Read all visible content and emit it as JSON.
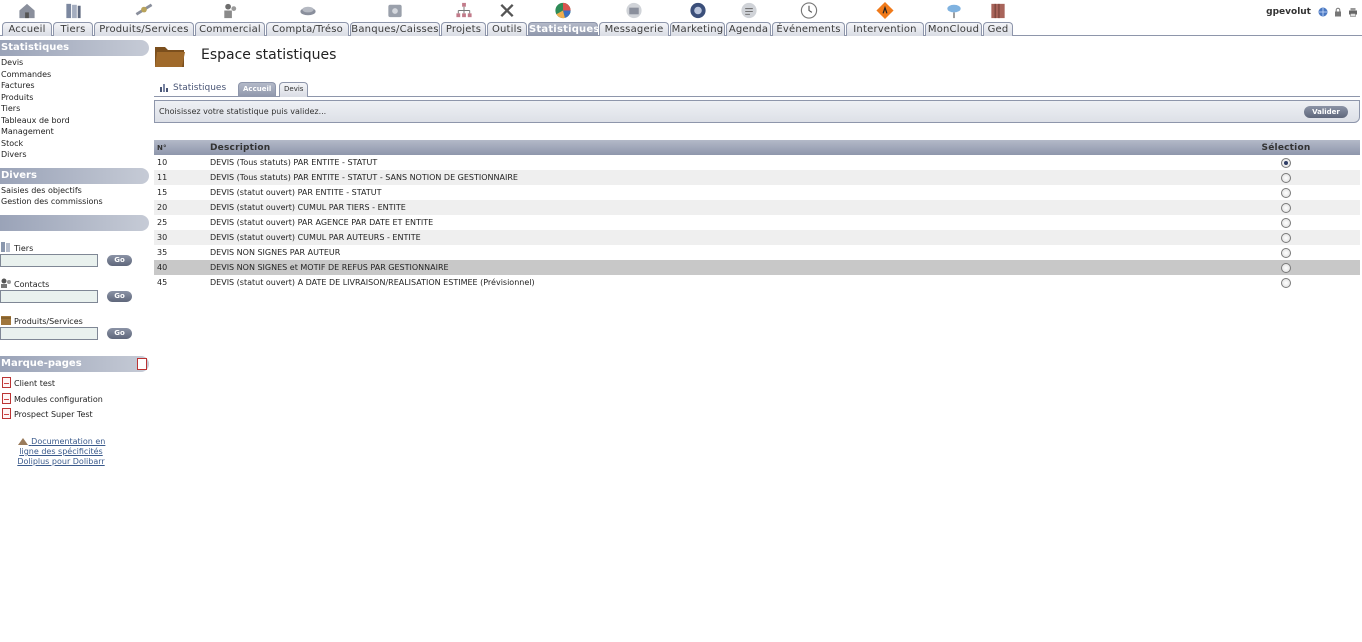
{
  "topmenu": {
    "tabs": [
      {
        "label": "Accueil",
        "icon": "home-icon",
        "width": 50
      },
      {
        "label": "Tiers",
        "icon": "books-icon",
        "width": 40
      },
      {
        "label": "Produits/Services",
        "icon": "satellite-icon",
        "width": 100
      },
      {
        "label": "Commercial",
        "icon": "people-icon",
        "width": 70
      },
      {
        "label": "Compta/Tréso",
        "icon": "money-icon",
        "width": 83
      },
      {
        "label": "Banques/Caisses",
        "icon": "safe-icon",
        "width": 90
      },
      {
        "label": "Projets",
        "icon": "hierarchy-icon",
        "width": 45
      },
      {
        "label": "Outils",
        "icon": "tools-icon",
        "width": 40
      },
      {
        "label": "Statistiques",
        "icon": "pie-chart-icon",
        "width": 70,
        "active": true
      },
      {
        "label": "Messagerie",
        "icon": "mail-icon",
        "width": 70
      },
      {
        "label": "Marketing",
        "icon": "marketing-icon",
        "width": 55
      },
      {
        "label": "Agenda",
        "icon": "agenda-icon",
        "width": 45
      },
      {
        "label": "Événements",
        "icon": "clock-icon",
        "width": 73
      },
      {
        "label": "Intervention",
        "icon": "roadwork-sign-icon",
        "width": 78
      },
      {
        "label": "MonCloud",
        "icon": "cloud-icon",
        "width": 57
      },
      {
        "label": "Ged",
        "icon": "archive-icon",
        "width": 30
      }
    ]
  },
  "user": {
    "name": "gpevolut"
  },
  "leftmenu": {
    "stats_title": "Statistiques",
    "stats_items": [
      "Devis",
      "Commandes",
      "Factures",
      "Produits",
      "Tiers",
      "Tableaux de bord",
      "Management",
      "Stock",
      "Divers"
    ],
    "divers_title": "Divers",
    "divers_items": [
      "Saisies des objectifs",
      "Gestion des commissions"
    ],
    "search_tiers_label": "Tiers",
    "search_contacts_label": "Contacts",
    "search_products_label": "Produits/Services",
    "go_label": "Go",
    "bookmarks_title": "Marque-pages",
    "bookmarks": [
      "Client test",
      "Modules configuration",
      "Prospect Super Test"
    ],
    "doc_link": "Documentation en ligne des spécificités Doliplus pour Dolibarr"
  },
  "main": {
    "title": "Espace statistiques",
    "subtabs_title": "Statistiques",
    "subtab_accueil": "Accueil",
    "subtab_devis": "Devis",
    "choose_text": "Choisissez votre statistique puis validez...",
    "valider_label": "Valider",
    "table": {
      "headers": {
        "num": "N°",
        "description": "Description",
        "selection": "Sélection"
      },
      "rows": [
        {
          "num": "10",
          "description": "DEVIS (Tous statuts) PAR ENTITE - STATUT",
          "selected": true
        },
        {
          "num": "11",
          "description": "DEVIS (Tous statuts) PAR ENTITE - STATUT - SANS NOTION DE GESTIONNAIRE",
          "selected": false
        },
        {
          "num": "15",
          "description": "DEVIS (statut ouvert) PAR ENTITE - STATUT",
          "selected": false
        },
        {
          "num": "20",
          "description": "DEVIS (statut ouvert) CUMUL PAR TIERS - ENTITE",
          "selected": false
        },
        {
          "num": "25",
          "description": "DEVIS (statut ouvert) PAR AGENCE PAR DATE ET ENTITE",
          "selected": false
        },
        {
          "num": "30",
          "description": "DEVIS (statut ouvert) CUMUL PAR AUTEURS - ENTITE",
          "selected": false
        },
        {
          "num": "35",
          "description": "DEVIS NON SIGNES PAR AUTEUR",
          "selected": false
        },
        {
          "num": "40",
          "description": "DEVIS NON SIGNES et MOTIF DE REFUS PAR GESTIONNAIRE",
          "selected": false,
          "hover": true
        },
        {
          "num": "45",
          "description": "DEVIS (statut ouvert) A DATE DE LIVRAISON/REALISATION ESTIMEE (Prévisionnel)",
          "selected": false
        }
      ]
    }
  },
  "colors": {
    "accent": "#8e96ab",
    "button": "#5f677b",
    "row_alt": "#efefef",
    "row_hover": "#c8c8c8"
  }
}
